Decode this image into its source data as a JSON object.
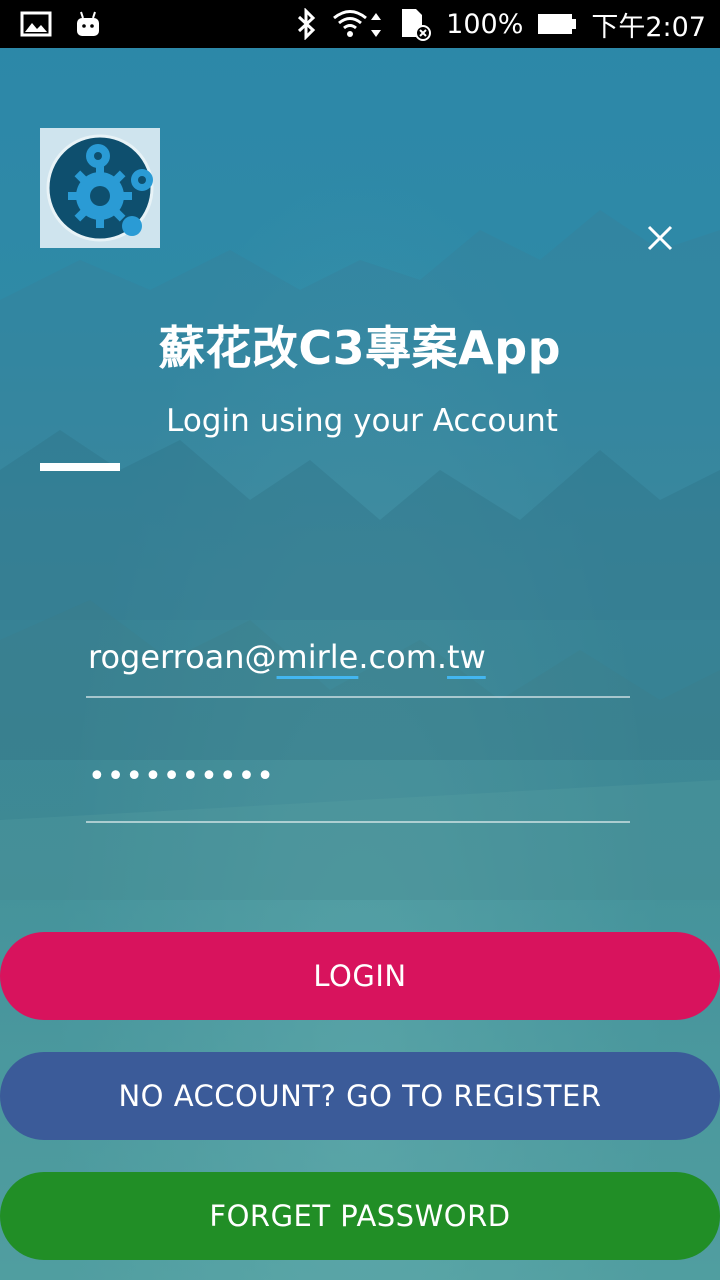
{
  "status_bar": {
    "battery": "100%",
    "time": "下午2:07",
    "icons": [
      "image-icon",
      "android-icon",
      "bluetooth-icon",
      "wifi-icon",
      "sd-card-icon",
      "battery-icon"
    ]
  },
  "app": {
    "title": "蘇花改C3專案App",
    "subtitle": "Login using your Account",
    "logo_icon": "gears-icon",
    "close_icon": "close-icon"
  },
  "form": {
    "email_value": "rogerroan@mirle.com.tw",
    "email_parts": [
      "rogerroan@",
      "mirle",
      ".com.",
      "tw"
    ],
    "password_value": "••••••••••"
  },
  "buttons": {
    "login": "LOGIN",
    "register": "NO ACCOUNT? GO TO REGISTER",
    "forget": "FORGET PASSWORD"
  },
  "colors": {
    "login": "#d8135d",
    "register": "#3b5b99",
    "forget": "#218e26",
    "spell_underline": "#43b6f0"
  }
}
